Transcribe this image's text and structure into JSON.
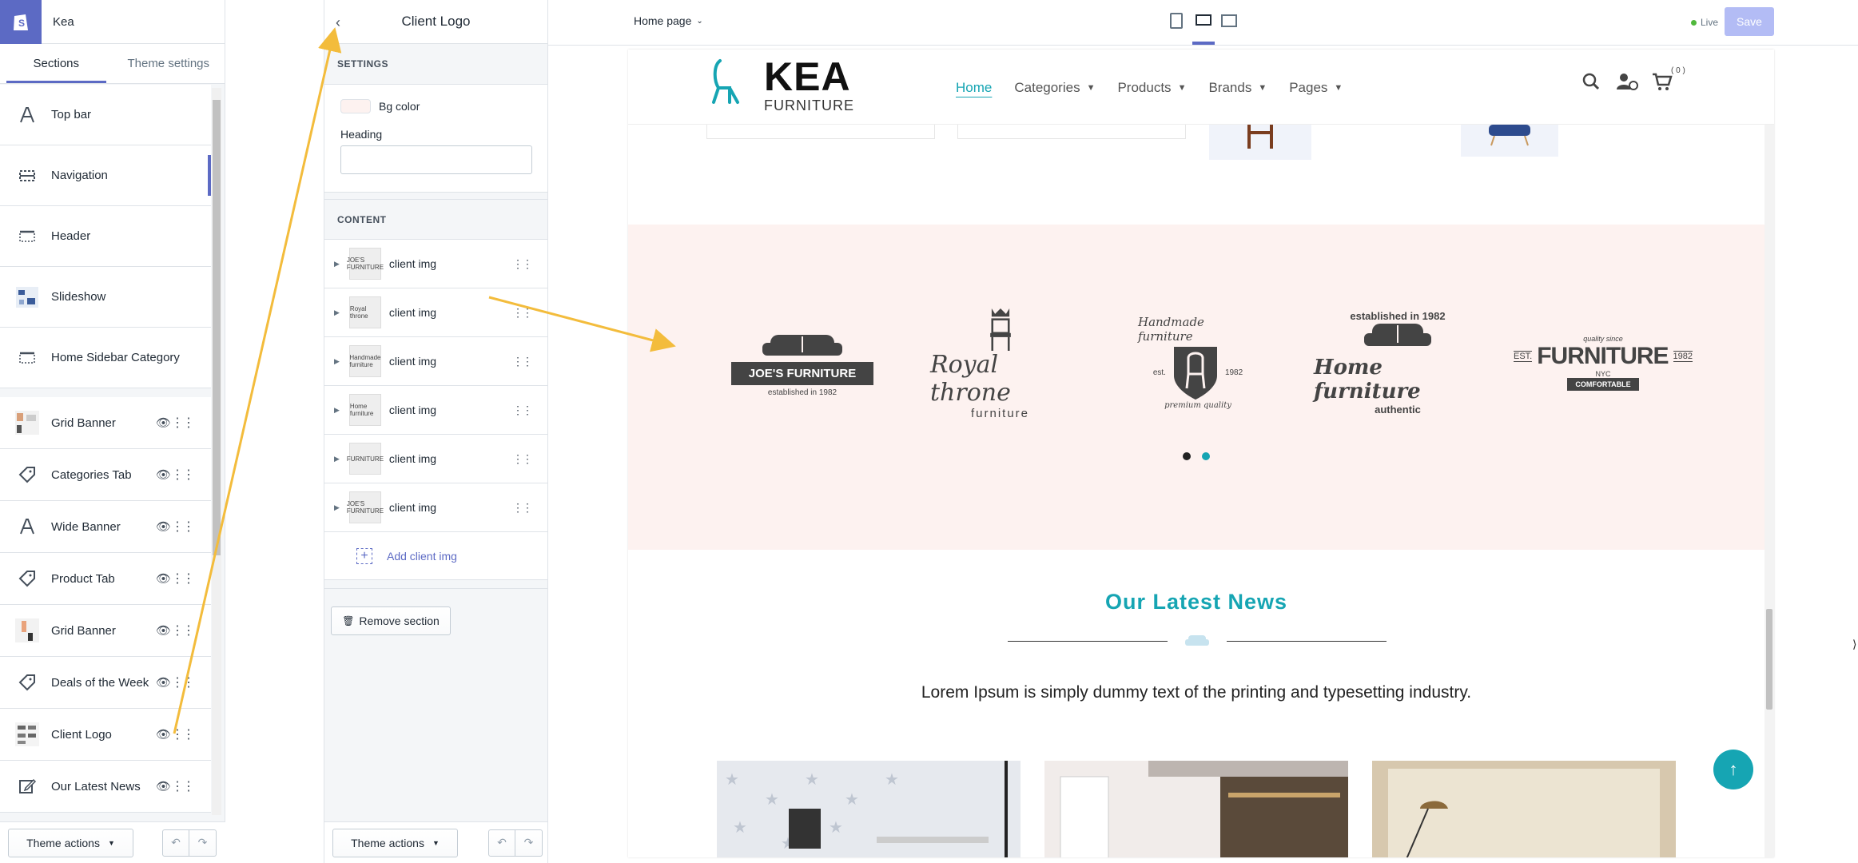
{
  "store": {
    "name": "Kea"
  },
  "left_tabs": [
    {
      "label": "Sections"
    },
    {
      "label": "Theme settings"
    }
  ],
  "sections": [
    {
      "label": "Top bar",
      "icon": "type-icon"
    },
    {
      "label": "Navigation",
      "icon": "navigation-icon"
    },
    {
      "label": "Header",
      "icon": "header-icon"
    },
    {
      "label": "Slideshow",
      "icon": "slideshow-thumb"
    },
    {
      "label": "Home Sidebar Category",
      "icon": "sidebar-icon"
    },
    {
      "label": "Grid Banner",
      "icon": "grid-banner-thumb"
    },
    {
      "label": "Categories Tab",
      "icon": "tag-icon"
    },
    {
      "label": "Wide Banner",
      "icon": "type-icon"
    },
    {
      "label": "Product Tab",
      "icon": "tag-icon"
    },
    {
      "label": "Grid Banner",
      "icon": "grid-banner-thumb"
    },
    {
      "label": "Deals of the Week",
      "icon": "tag-icon"
    },
    {
      "label": "Client Logo",
      "icon": "client-logo-thumb"
    },
    {
      "label": "Our Latest News",
      "icon": "edit-icon"
    }
  ],
  "footer": {
    "theme_actions": "Theme actions"
  },
  "panel": {
    "title": "Client Logo",
    "settings_caption": "SETTINGS",
    "bg_color_label": "Bg color",
    "heading_label": "Heading",
    "heading_value": "",
    "content_caption": "CONTENT",
    "items": [
      {
        "label": "client img",
        "thumb": "JOE'S FURNITURE"
      },
      {
        "label": "client img",
        "thumb": "Royal throne"
      },
      {
        "label": "client img",
        "thumb": "Handmade furniture"
      },
      {
        "label": "client img",
        "thumb": "Home furniture"
      },
      {
        "label": "client img",
        "thumb": "FURNITURE"
      },
      {
        "label": "client img",
        "thumb": "JOE'S FURNITURE"
      }
    ],
    "add_label": "Add client img",
    "remove_label": "Remove section"
  },
  "topbar": {
    "page_select": "Home page",
    "live_label": "Live",
    "save_label": "Save"
  },
  "site": {
    "logo_main": "KEA",
    "logo_sub": "FURNITURE",
    "nav": [
      "Home",
      "Categories",
      "Products",
      "Brands",
      "Pages"
    ],
    "cart_count": "( 0 )",
    "client_logos": [
      {
        "main": "JOE'S FURNITURE",
        "sub": "established in 1982"
      },
      {
        "main": "Royal throne",
        "sub": "furniture"
      },
      {
        "main": "Handmade furniture",
        "sub": "premium quality",
        "extra1": "est.",
        "extra2": "1982"
      },
      {
        "main": "Home furniture",
        "sub": "authentic",
        "top": "established in 1982"
      },
      {
        "main": "FURNITURE",
        "sub": "COMFORTABLE",
        "extra1": "EST.",
        "extra2": "1982",
        "top": "quality since",
        "mid": "NYC"
      }
    ],
    "news_title": "Our Latest News",
    "news_desc": "Lorem Ipsum is simply dummy text of the printing and typesetting industry."
  },
  "colors": {
    "accent": "#5c6ac4",
    "teal": "#16a5b3",
    "pink_bg": "#fdf2f0",
    "annotation": "#f3bc3c"
  }
}
